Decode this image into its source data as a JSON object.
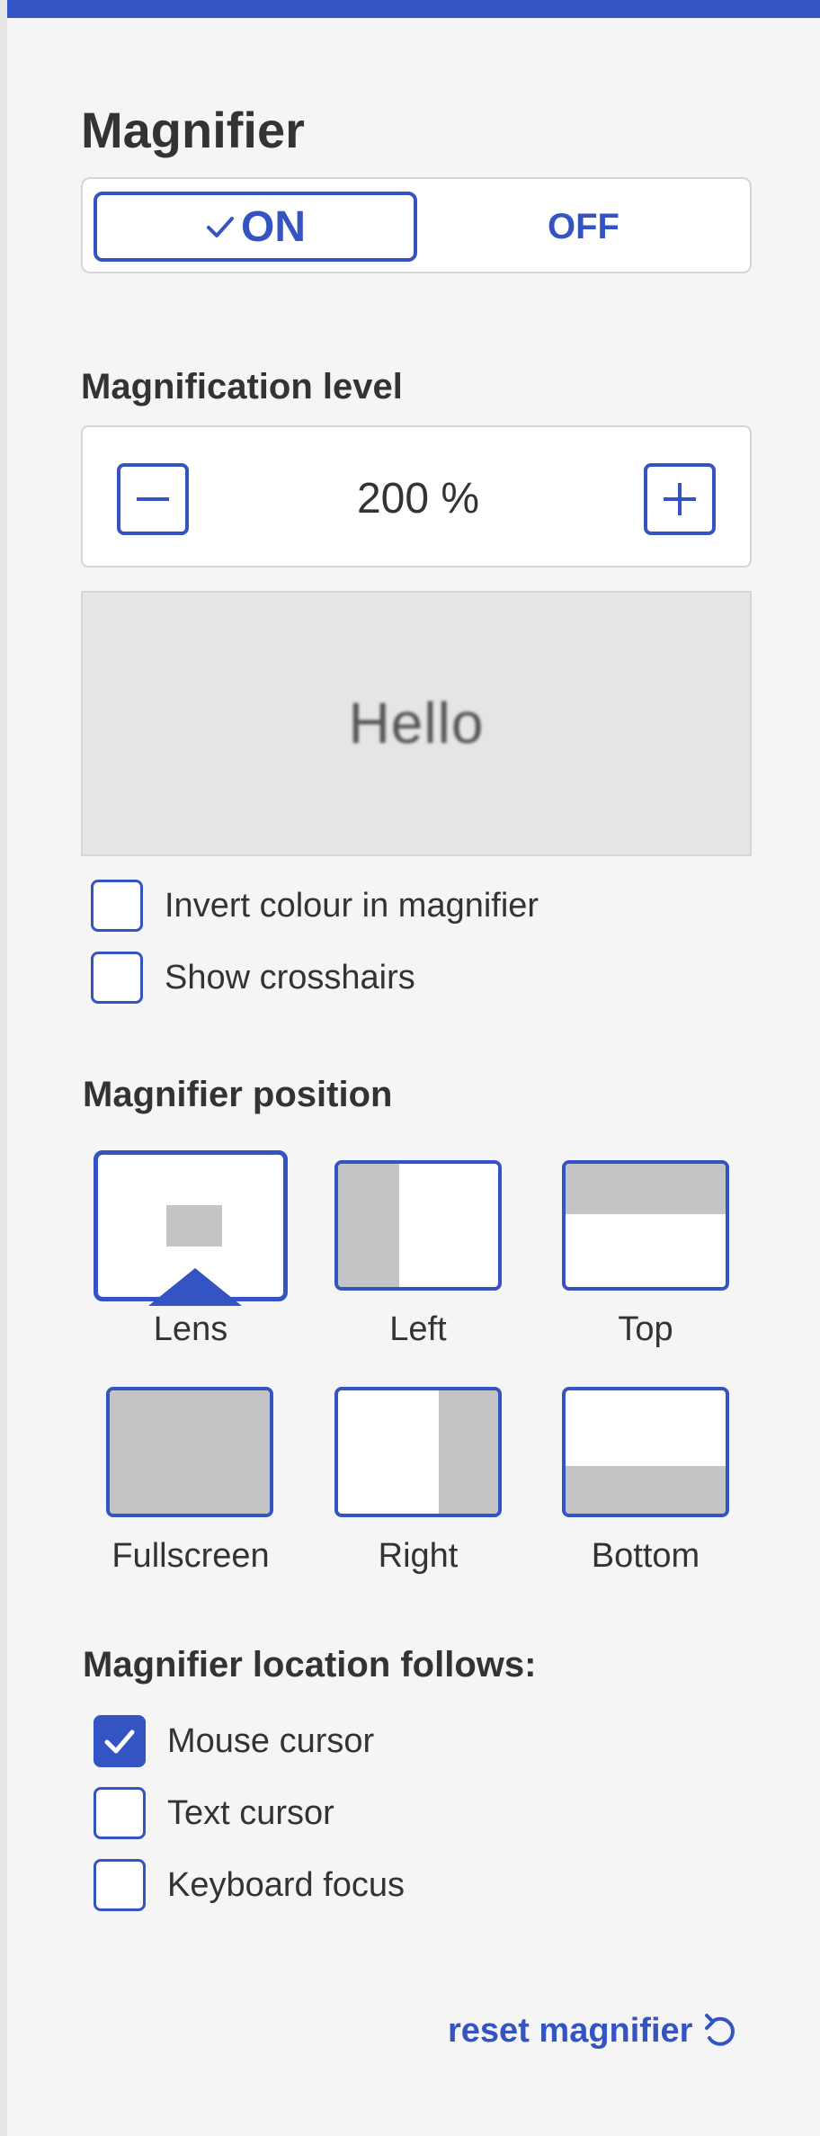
{
  "magnifier": {
    "title": "Magnifier",
    "toggle": {
      "on_label": "ON",
      "off_label": "OFF",
      "selected": "ON"
    }
  },
  "level": {
    "heading": "Magnification level",
    "value": "200 %",
    "decrease_icon": "minus-icon",
    "increase_icon": "plus-icon"
  },
  "preview": {
    "text": "Hello"
  },
  "options": [
    {
      "label": "Invert colour in magnifier",
      "checked": false
    },
    {
      "label": "Show crosshairs",
      "checked": false
    }
  ],
  "position": {
    "heading": "Magnifier position",
    "items": [
      {
        "label": "Lens",
        "selected": true
      },
      {
        "label": "Left",
        "selected": false
      },
      {
        "label": "Top",
        "selected": false
      },
      {
        "label": "Fullscreen",
        "selected": false
      },
      {
        "label": "Right",
        "selected": false
      },
      {
        "label": "Bottom",
        "selected": false
      }
    ]
  },
  "follows": {
    "heading": "Magnifier location follows:",
    "items": [
      {
        "label": "Mouse cursor",
        "checked": true
      },
      {
        "label": "Text cursor",
        "checked": false
      },
      {
        "label": "Keyboard focus",
        "checked": false
      }
    ]
  },
  "reset": {
    "label": "reset magnifier",
    "icon": "undo-icon"
  },
  "colors": {
    "accent": "#3554c3",
    "panel": "#f5f5f5",
    "fill": "#c4c4c4"
  }
}
